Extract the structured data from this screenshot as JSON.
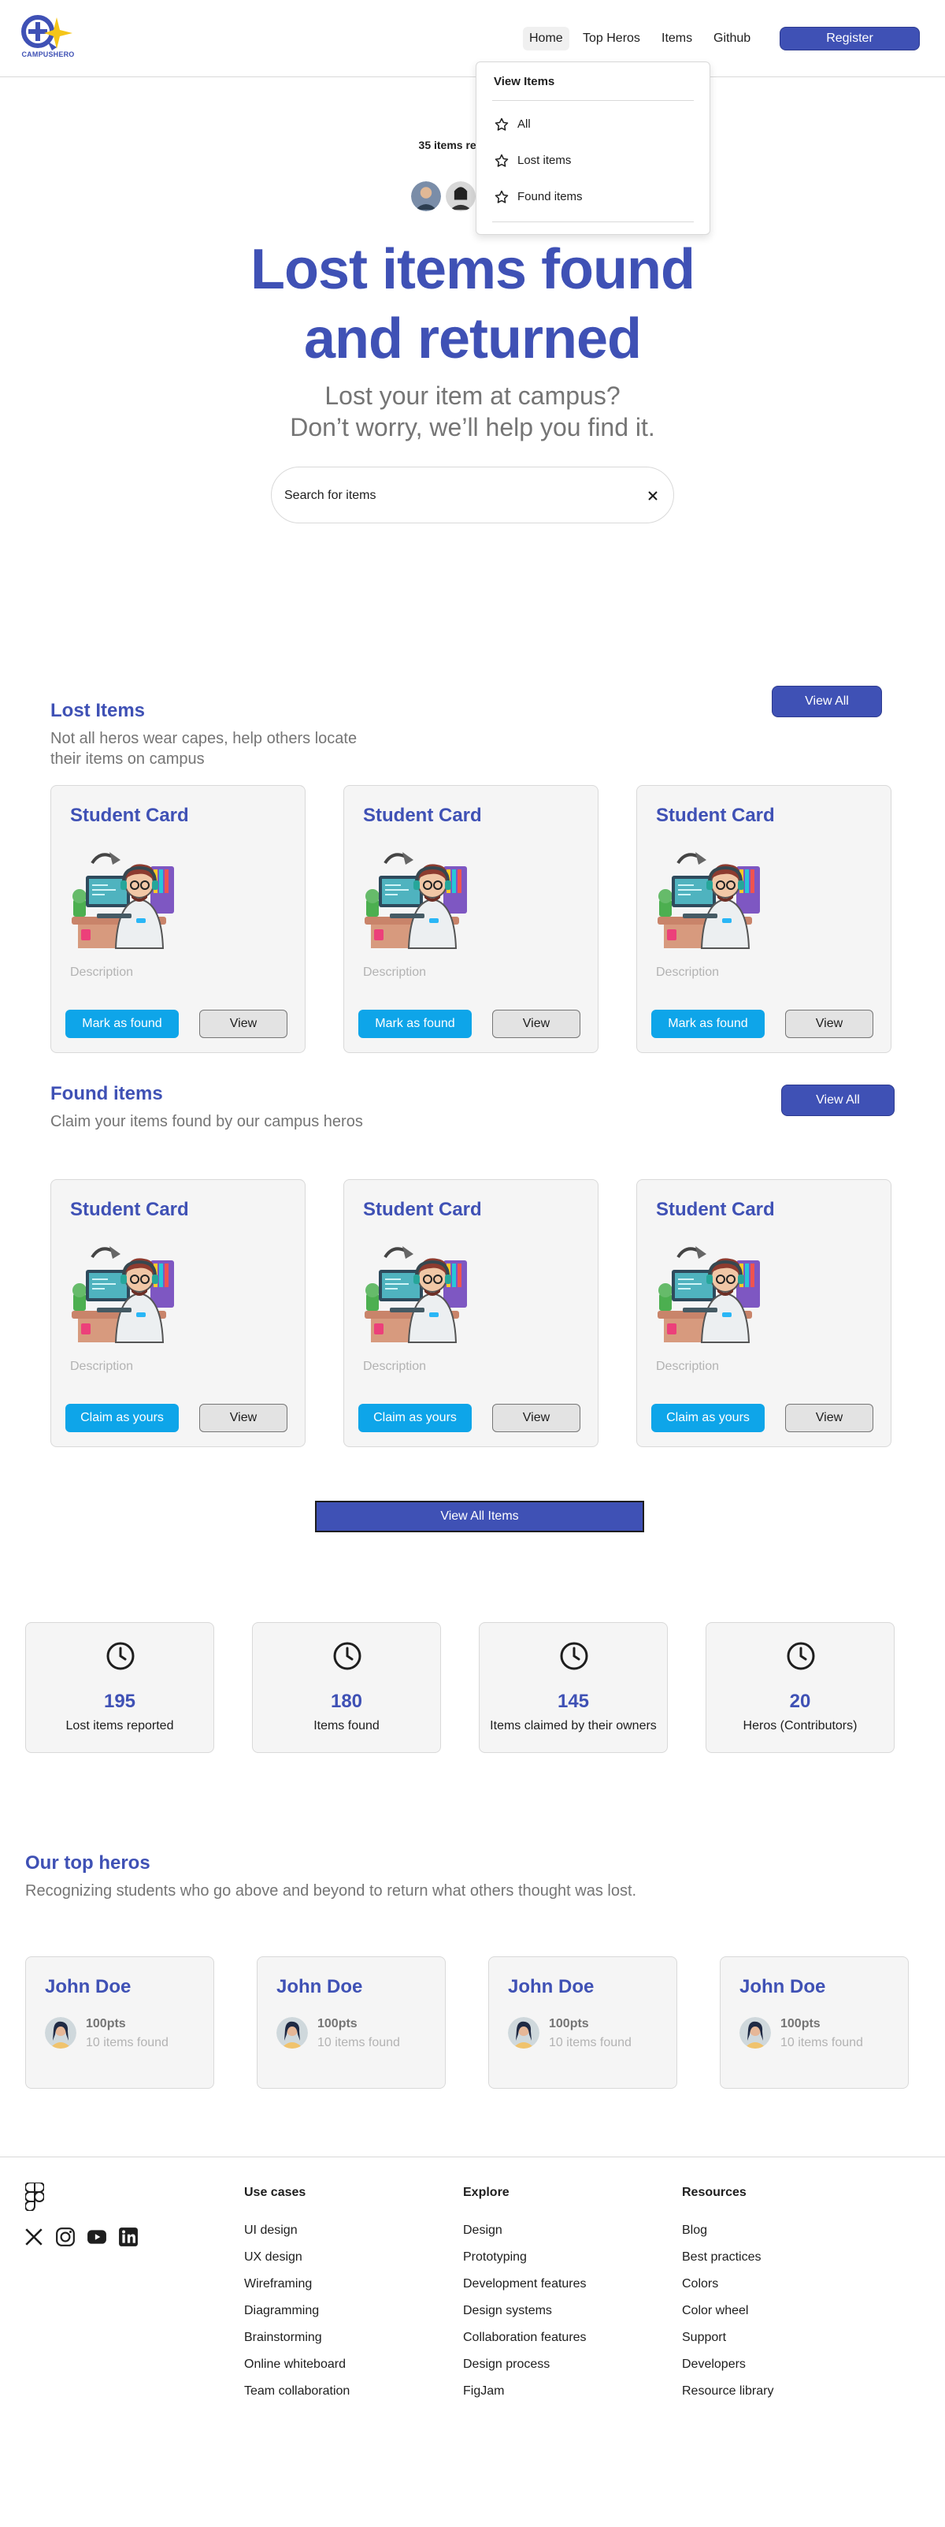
{
  "header": {
    "logo_text": "CAMPUSHERO",
    "nav": [
      "Home",
      "Top Heros",
      "Items",
      "Github"
    ],
    "register_label": "Register"
  },
  "dropdown": {
    "title": "View Items",
    "items": [
      "All",
      "Lost items",
      "Found items"
    ]
  },
  "hero": {
    "note": "35 items returned an",
    "title_line1": "Lost items found",
    "title_line2": "and returned",
    "sub_line1": "Lost your item at campus?",
    "sub_line2": "Don’t worry, we’ll help you find it.",
    "search_placeholder": "Search for items"
  },
  "lost": {
    "title": "Lost Items",
    "subtitle_line1": "Not all heros wear capes, help others locate",
    "subtitle_line2": "their items on campus",
    "view_all": "View All",
    "cards": [
      {
        "title": "Student Card",
        "desc": "Description",
        "action": "Mark as found",
        "view": "View"
      },
      {
        "title": "Student Card",
        "desc": "Description",
        "action": "Mark as found",
        "view": "View"
      },
      {
        "title": "Student Card",
        "desc": "Description",
        "action": "Mark as found",
        "view": "View"
      }
    ]
  },
  "found": {
    "title": "Found items",
    "subtitle": "Claim your items found by our campus heros",
    "view_all": "View All",
    "cards": [
      {
        "title": "Student Card",
        "desc": "Description",
        "action": "Claim as yours",
        "view": "View"
      },
      {
        "title": "Student Card",
        "desc": "Description",
        "action": "Claim as yours",
        "view": "View"
      },
      {
        "title": "Student Card",
        "desc": "Description",
        "action": "Claim as yours",
        "view": "View"
      }
    ]
  },
  "view_all_items": "View All Items",
  "stats": [
    {
      "value": "195",
      "label": "Lost items reported"
    },
    {
      "value": "180",
      "label": "Items found"
    },
    {
      "value": "145",
      "label": "Items claimed by their owners"
    },
    {
      "value": "20",
      "label": "Heros (Contributors)"
    }
  ],
  "top_heros": {
    "title": "Our top heros",
    "subtitle": "Recognizing students who go above and beyond to return what others thought was lost.",
    "cards": [
      {
        "name": "John Doe",
        "points": "100pts",
        "items": "10 items found"
      },
      {
        "name": "John Doe",
        "points": "100pts",
        "items": "10 items found"
      },
      {
        "name": "John Doe",
        "points": "100pts",
        "items": "10 items found"
      },
      {
        "name": "John Doe",
        "points": "100pts",
        "items": "10 items found"
      }
    ]
  },
  "footer": {
    "columns": [
      {
        "title": "Use cases",
        "links": [
          "UI design",
          "UX design",
          "Wireframing",
          "Diagramming",
          "Brainstorming",
          "Online whiteboard",
          "Team collaboration"
        ]
      },
      {
        "title": "Explore",
        "links": [
          "Design",
          "Prototyping",
          "Development features",
          "Design systems",
          "Collaboration features",
          "Design process",
          "FigJam"
        ]
      },
      {
        "title": "Resources",
        "links": [
          "Blog",
          "Best practices",
          "Colors",
          "Color wheel",
          "Support",
          "Developers",
          "Resource library"
        ]
      }
    ]
  },
  "colors": {
    "brand": "#3f51b5",
    "accent": "#0ea5e9",
    "muted": "#757575"
  }
}
